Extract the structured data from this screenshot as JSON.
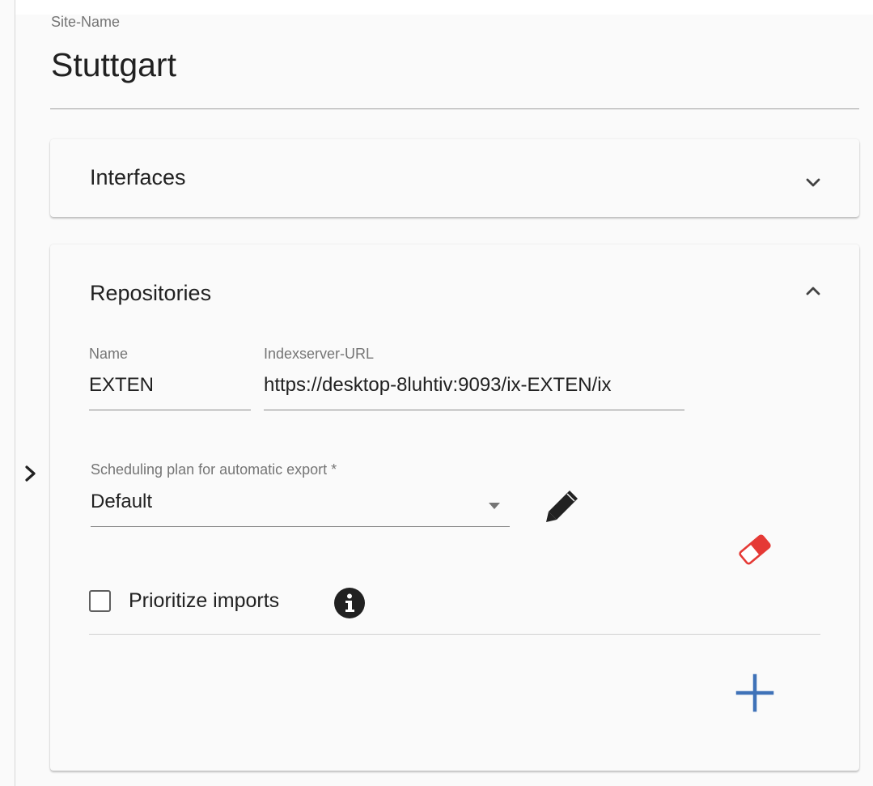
{
  "site": {
    "label": "Site-Name",
    "value": "Stuttgart"
  },
  "interfaces_panel": {
    "title": "Interfaces",
    "expanded": false,
    "toggle_icon": "chevron-down-icon"
  },
  "repositories_panel": {
    "title": "Repositories",
    "expanded": true,
    "toggle_icon": "chevron-up-icon",
    "name": {
      "label": "Name",
      "value": "EXTEN"
    },
    "indexserver_url": {
      "label": "Indexserver-URL",
      "value": "https://desktop-8luhtiv:9093/ix-EXTEN/ix"
    },
    "scheduling_plan": {
      "label": "Scheduling plan for automatic export *",
      "value": "Default",
      "dropdown_icon": "dropdown-arrow-icon",
      "edit_icon": "pencil-icon",
      "clear_icon": "eraser-icon"
    },
    "prioritize_imports": {
      "label": "Prioritize imports",
      "checked": false,
      "info_icon": "info-icon"
    },
    "add_icon": "plus-icon"
  },
  "sidebar_toggle_icon": "chevron-right-icon",
  "colors": {
    "eraser": "#e53935",
    "add": "#3f72b8",
    "icon_dark": "#212121"
  }
}
